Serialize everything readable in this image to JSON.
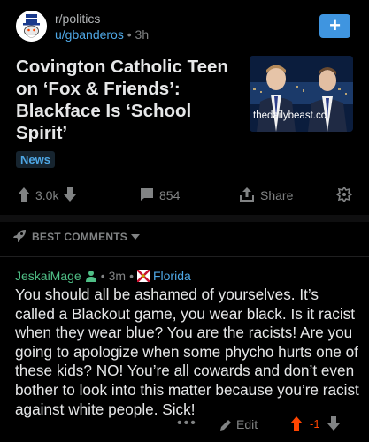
{
  "post": {
    "subreddit": "r/politics",
    "author": "u/gbanderos",
    "age": "3h",
    "title": "Covington Catholic Teen on ‘Fox & Friends’: Blackface Is ‘School Spirit’",
    "thumbnail_caption": "thedailybeast.cc",
    "flair": "News",
    "score": "3.0k",
    "comments": "854",
    "share_label": "Share"
  },
  "sort": {
    "label": "BEST COMMENTS"
  },
  "comment": {
    "author": "JeskaiMage",
    "age": "3m",
    "flair": "Florida",
    "body": "You should all be ashamed of yourselves.  It’s called a Blackout game, you wear black.  Is it racist when they wear blue?  You are the racists! Are you going to apologize when some phycho hurts one of these kids? NO!  You’re all cowards and don’t even bother to look into this matter because you’re racist against white people.  Sick!",
    "more": "•••",
    "edit_label": "Edit",
    "score": "-1"
  },
  "colors": {
    "accent_blue": "#3f95e0",
    "link_blue": "#4fa8e6",
    "username_green": "#4fbf86",
    "upvote_orange": "#ff4500"
  }
}
